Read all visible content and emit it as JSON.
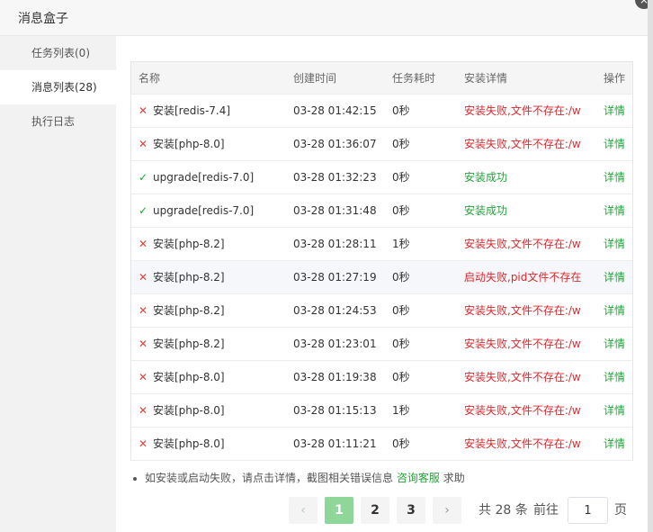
{
  "window": {
    "title": "消息盒子",
    "close_glyph": "×"
  },
  "sidebar": {
    "items": [
      {
        "label": "任务列表(0)",
        "active": false
      },
      {
        "label": "消息列表(28)",
        "active": true
      },
      {
        "label": "执行日志",
        "active": false
      }
    ]
  },
  "table": {
    "columns": [
      "名称",
      "创建时间",
      "任务耗时",
      "安装详情",
      "操作"
    ],
    "rows": [
      {
        "status": "fail",
        "name": "安装[redis-7.4]",
        "time": "03-28 01:42:15",
        "duration": "0秒",
        "detail": "安装失败,文件不存在:/ww",
        "action": "详情"
      },
      {
        "status": "fail",
        "name": "安装[php-8.0]",
        "time": "03-28 01:36:07",
        "duration": "0秒",
        "detail": "安装失败,文件不存在:/ww",
        "action": "详情"
      },
      {
        "status": "ok",
        "name": "upgrade[redis-7.0]",
        "time": "03-28 01:32:23",
        "duration": "0秒",
        "detail": "安装成功",
        "action": "详情"
      },
      {
        "status": "ok",
        "name": "upgrade[redis-7.0]",
        "time": "03-28 01:31:48",
        "duration": "0秒",
        "detail": "安装成功",
        "action": "详情"
      },
      {
        "status": "fail",
        "name": "安装[php-8.2]",
        "time": "03-28 01:28:11",
        "duration": "1秒",
        "detail": "安装失败,文件不存在:/ww",
        "action": "详情"
      },
      {
        "status": "fail",
        "name": "安装[php-8.2]",
        "time": "03-28 01:27:19",
        "duration": "0秒",
        "detail": "启动失败,pid文件不存在",
        "action": "详情"
      },
      {
        "status": "fail",
        "name": "安装[php-8.2]",
        "time": "03-28 01:24:53",
        "duration": "0秒",
        "detail": "安装失败,文件不存在:/ww",
        "action": "详情"
      },
      {
        "status": "fail",
        "name": "安装[php-8.2]",
        "time": "03-28 01:23:01",
        "duration": "0秒",
        "detail": "安装失败,文件不存在:/ww",
        "action": "详情"
      },
      {
        "status": "fail",
        "name": "安装[php-8.0]",
        "time": "03-28 01:19:38",
        "duration": "0秒",
        "detail": "安装失败,文件不存在:/ww",
        "action": "详情"
      },
      {
        "status": "fail",
        "name": "安装[php-8.0]",
        "time": "03-28 01:15:13",
        "duration": "1秒",
        "detail": "安装失败,文件不存在:/ww",
        "action": "详情"
      },
      {
        "status": "fail",
        "name": "安装[php-8.0]",
        "time": "03-28 01:11:21",
        "duration": "0秒",
        "detail": "安装失败,文件不存在:/ww",
        "action": "详情"
      }
    ],
    "highlighted_row_index": 5
  },
  "notice": {
    "text": "如安装或启动失败，请点击详情，截图相关错误信息",
    "link": "咨询客服",
    "suffix": "求助"
  },
  "pagination": {
    "prev": "‹",
    "next": "›",
    "pages": [
      "1",
      "2",
      "3"
    ],
    "current_page": "1",
    "total": "共 28 条",
    "goto": "前往",
    "goto_value": "1",
    "unit": "页"
  },
  "colors": {
    "success": "#20a53a",
    "failure": "#e0262b",
    "active_page": "#8fd69b"
  },
  "icons": {
    "fail": "cross-icon ✕",
    "ok": "check-icon ✓"
  }
}
